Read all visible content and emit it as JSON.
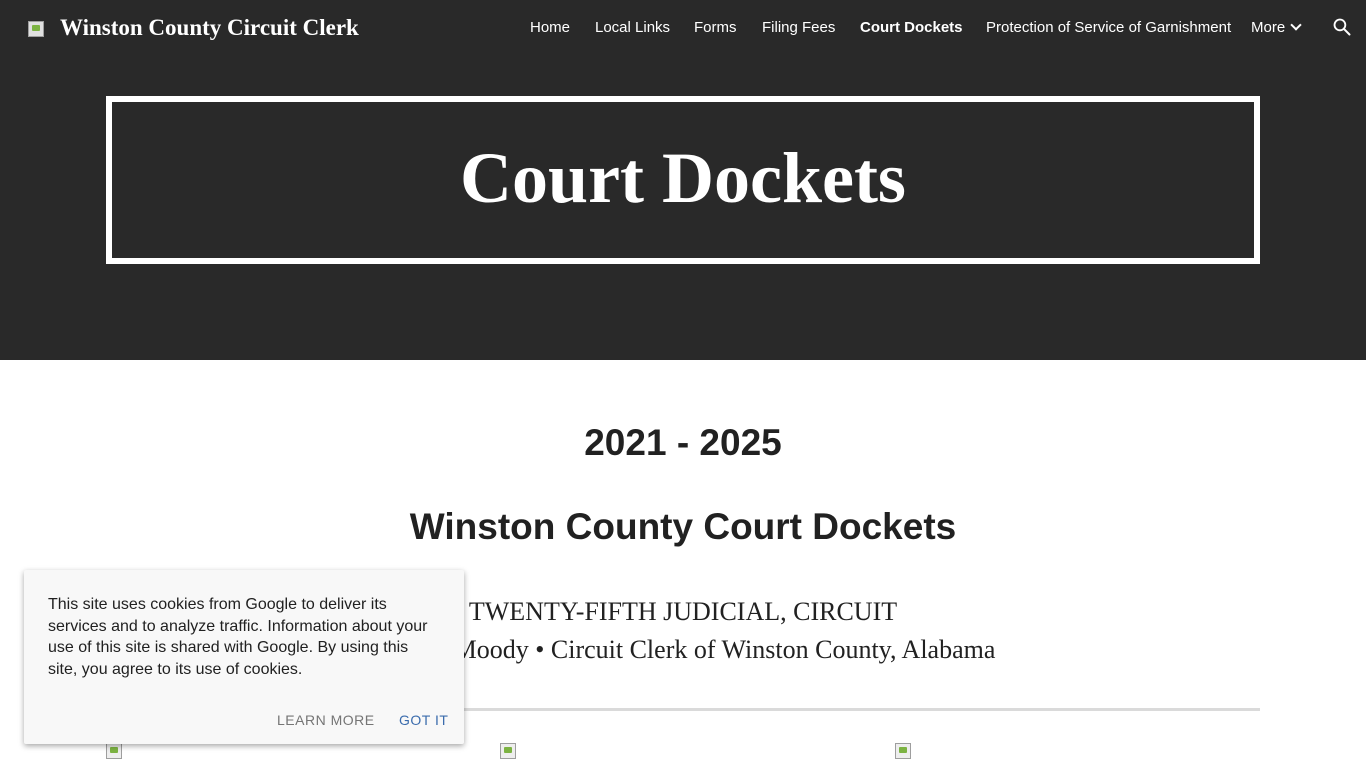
{
  "site": {
    "title": "Winston County Circuit Clerk"
  },
  "nav": {
    "items": [
      {
        "label": "Home"
      },
      {
        "label": "Local Links"
      },
      {
        "label": "Forms"
      },
      {
        "label": "Filing Fees"
      },
      {
        "label": "Court Dockets",
        "active": true
      },
      {
        "label": "Protection of Service of Garnishment"
      },
      {
        "label": "More"
      }
    ],
    "search_icon": "search-icon"
  },
  "hero": {
    "title": "Court Dockets"
  },
  "main": {
    "years": "2021 - 2025",
    "heading": "Winston County Court Dockets",
    "circuit": "TWENTY-FIFTH JUDICIAL, CIRCUIT",
    "clerk": "Christy Moody • Circuit Clerk of Winston County, Alabama"
  },
  "cookie_banner": {
    "text": "This site uses cookies from Google to deliver its services and to analyze traffic. Information about your use of this site is shared with Google. By using this site, you agree to its use of cookies.",
    "learn_more": "LEARN MORE",
    "got_it": "GOT IT"
  },
  "colors": {
    "header_bg": "#292929",
    "link_accent": "#3b6cad",
    "divider": "#dadada"
  }
}
